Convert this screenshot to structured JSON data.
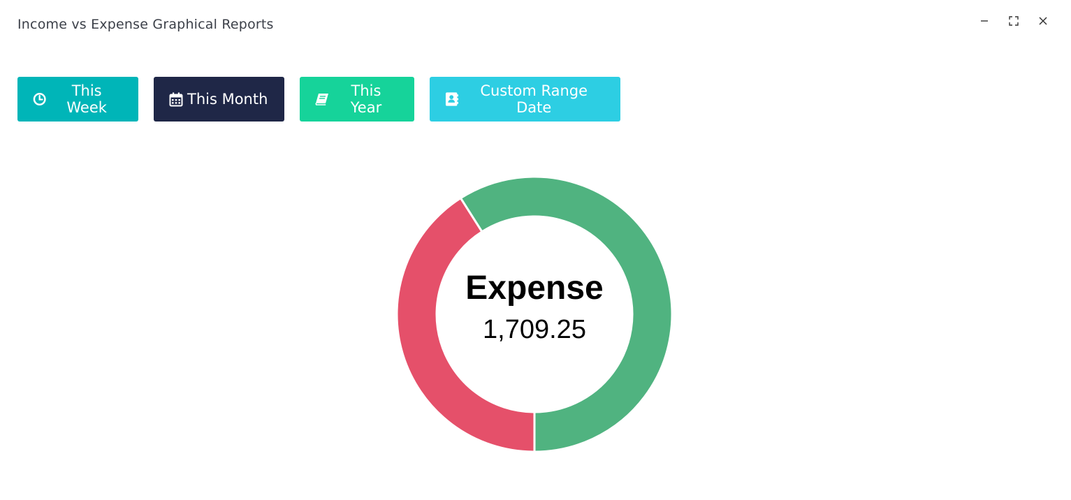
{
  "window": {
    "title": "Income vs Expense Graphical Reports"
  },
  "toolbar": {
    "buttons": [
      {
        "label": "This Week",
        "icon": "clock-icon",
        "color": "#00b5b8"
      },
      {
        "label": "This Month",
        "icon": "calendar-icon",
        "color": "#1f2747"
      },
      {
        "label": "This Year",
        "icon": "book-icon",
        "color": "#16d39a"
      },
      {
        "label": "Custom Range Date",
        "icon": "contact-book-icon",
        "color": "#2dcee3"
      }
    ]
  },
  "chart_data": {
    "type": "pie",
    "variant": "doughnut",
    "slices": [
      {
        "label": "Expense",
        "fraction": 0.41,
        "color": "#e5506a"
      },
      {
        "label": "",
        "fraction": 0.59,
        "color": "#50b380"
      }
    ],
    "center": {
      "label": "Expense",
      "value": "1,709.25"
    }
  }
}
